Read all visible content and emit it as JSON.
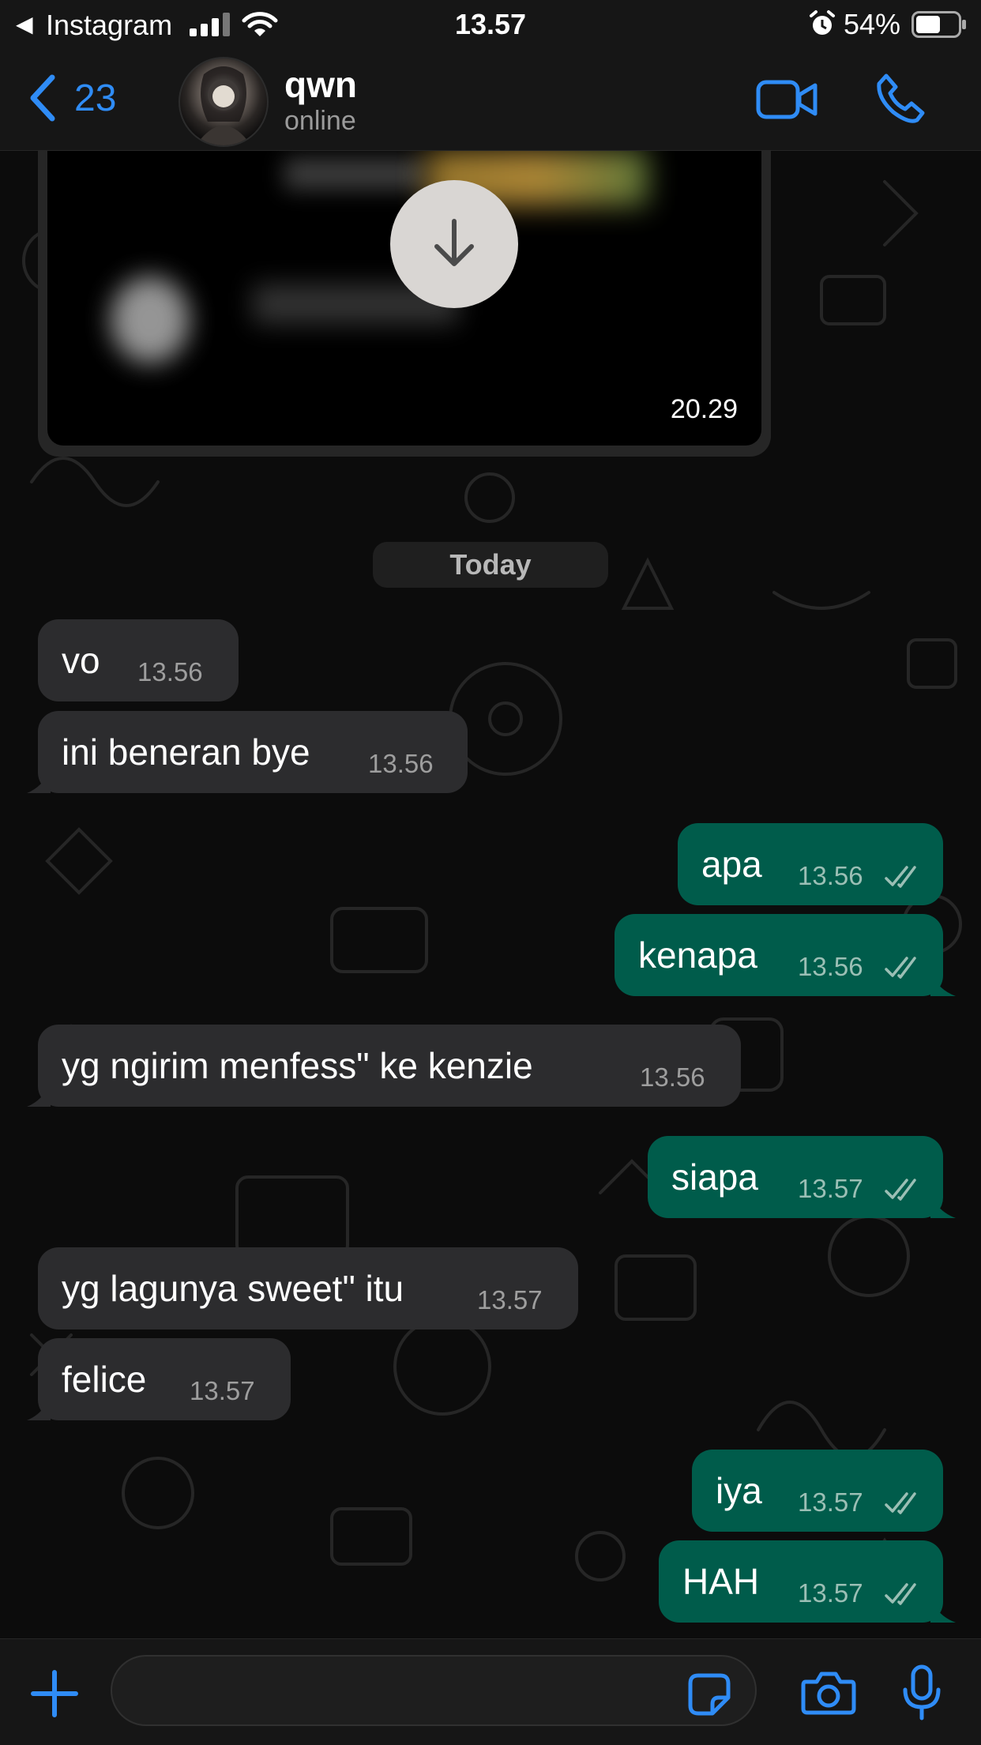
{
  "status_bar": {
    "back_app": "Instagram",
    "time": "13.57",
    "battery": "54%"
  },
  "header": {
    "back_count": "23",
    "contact_name": "qwn",
    "contact_status": "online"
  },
  "media_message": {
    "time": "20.29"
  },
  "date_separator": "Today",
  "messages": [
    {
      "dir": "in",
      "text": "vo",
      "time": "13.56"
    },
    {
      "dir": "in",
      "text": "ini beneran bye",
      "time": "13.56"
    },
    {
      "dir": "out",
      "text": "apa",
      "time": "13.56"
    },
    {
      "dir": "out",
      "text": "kenapa",
      "time": "13.56"
    },
    {
      "dir": "in",
      "text": "yg ngirim menfess\" ke kenzie",
      "time": "13.56"
    },
    {
      "dir": "out",
      "text": "siapa",
      "time": "13.57"
    },
    {
      "dir": "in",
      "text": "yg lagunya sweet\" itu",
      "time": "13.57"
    },
    {
      "dir": "in",
      "text": "felice",
      "time": "13.57"
    },
    {
      "dir": "out",
      "text": "iya",
      "time": "13.57"
    },
    {
      "dir": "out",
      "text": "HAH",
      "time": "13.57"
    }
  ],
  "input": {
    "placeholder": ""
  },
  "colors": {
    "accent": "#2f8cf6",
    "incoming_bubble": "#2c2c2e",
    "outgoing_bubble": "#005c4b",
    "read_ticks": "#9bbfb5"
  }
}
